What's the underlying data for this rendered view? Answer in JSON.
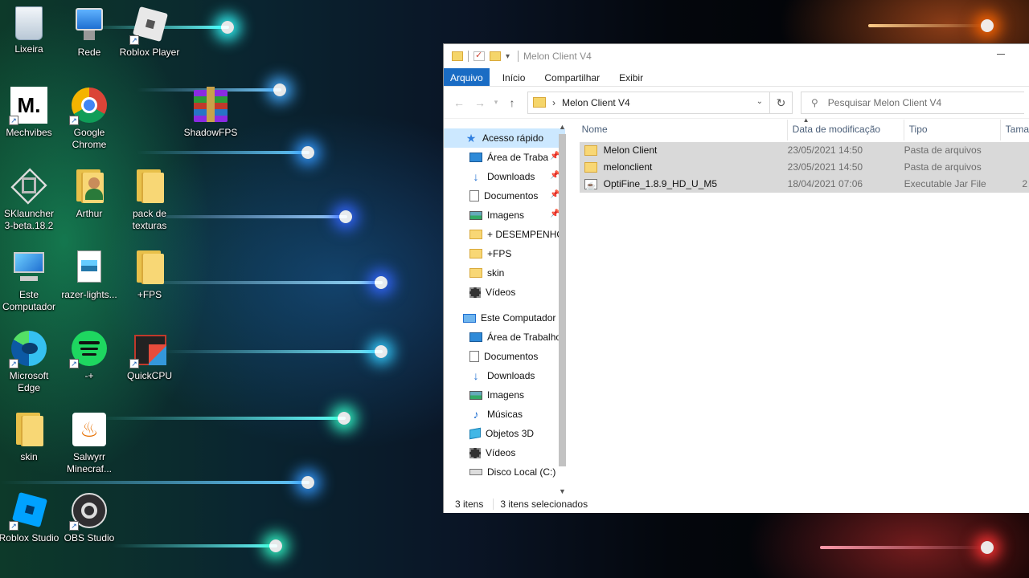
{
  "desktop": {
    "icons": [
      {
        "label": "Lixeira",
        "icon": "recycle-bin-icon"
      },
      {
        "label": "Rede",
        "icon": "network-icon"
      },
      {
        "label": "Roblox Player",
        "icon": "roblox-player-icon"
      },
      {
        "label": "Mechvibes",
        "icon": "mechvibes-icon",
        "glyph": "M."
      },
      {
        "label": "Google Chrome",
        "icon": "chrome-icon"
      },
      {
        "label": "ShadowFPS",
        "icon": "winrar-icon"
      },
      {
        "label": "SKlauncher 3-beta.18.2",
        "icon": "sklauncher-icon"
      },
      {
        "label": "Arthur",
        "icon": "user-folder-icon"
      },
      {
        "label": "pack de texturas",
        "icon": "folder-icon"
      },
      {
        "label": "Este Computador",
        "icon": "computer-icon"
      },
      {
        "label": "razer-lights...",
        "icon": "image-file-icon"
      },
      {
        "label": "+FPS",
        "icon": "folder-icon"
      },
      {
        "label": "Microsoft Edge",
        "icon": "edge-icon"
      },
      {
        "label": "-+",
        "icon": "spotify-icon"
      },
      {
        "label": "QuickCPU",
        "icon": "quickcpu-icon"
      },
      {
        "label": "skin",
        "icon": "folder-icon"
      },
      {
        "label": "Salwyrr Minecraf...",
        "icon": "java-icon"
      },
      {
        "label": "Roblox Studio",
        "icon": "roblox-studio-icon"
      },
      {
        "label": "OBS Studio",
        "icon": "obs-icon"
      }
    ]
  },
  "window": {
    "title": "Melon Client V4",
    "ribbon_tabs": [
      "Arquivo",
      "Início",
      "Compartilhar",
      "Exibir"
    ],
    "address": "Melon Client V4",
    "search_placeholder": "Pesquisar Melon Client V4",
    "nav": {
      "quick_access": "Acesso rápido",
      "quick_items": [
        {
          "label": "Área de Traba",
          "icon": "desktop-icon",
          "pinned": true
        },
        {
          "label": "Downloads",
          "icon": "download-icon",
          "pinned": true
        },
        {
          "label": "Documentos",
          "icon": "documents-icon",
          "pinned": true
        },
        {
          "label": "Imagens",
          "icon": "pictures-icon",
          "pinned": true
        },
        {
          "label": "+ DESEMPENHO",
          "icon": "folder-icon",
          "pinned": false
        },
        {
          "label": "+FPS",
          "icon": "folder-icon",
          "pinned": false
        },
        {
          "label": "skin",
          "icon": "folder-icon",
          "pinned": false
        },
        {
          "label": "Vídeos",
          "icon": "videos-icon",
          "pinned": false
        }
      ],
      "this_pc": "Este Computador",
      "pc_items": [
        {
          "label": "Área de Trabalho",
          "icon": "desktop-icon"
        },
        {
          "label": "Documentos",
          "icon": "documents-icon"
        },
        {
          "label": "Downloads",
          "icon": "download-icon"
        },
        {
          "label": "Imagens",
          "icon": "pictures-icon"
        },
        {
          "label": "Músicas",
          "icon": "music-icon"
        },
        {
          "label": "Objetos 3D",
          "icon": "objects-3d-icon"
        },
        {
          "label": "Vídeos",
          "icon": "videos-icon"
        },
        {
          "label": "Disco Local (C:)",
          "icon": "disk-icon"
        }
      ]
    },
    "columns": [
      "Nome",
      "Data de modificação",
      "Tipo",
      "Tama"
    ],
    "files": [
      {
        "name": "Melon Client",
        "date": "23/05/2021 14:50",
        "type": "Pasta de arquivos",
        "size": "",
        "icon": "folder-icon"
      },
      {
        "name": "melonclient",
        "date": "23/05/2021 14:50",
        "type": "Pasta de arquivos",
        "size": "",
        "icon": "folder-icon"
      },
      {
        "name": "OptiFine_1.8.9_HD_U_M5",
        "date": "18/04/2021 07:06",
        "type": "Executable Jar File",
        "size": "2",
        "icon": "jar-file-icon"
      }
    ],
    "status": {
      "count": "3 itens",
      "selected": "3 itens selecionados"
    }
  }
}
